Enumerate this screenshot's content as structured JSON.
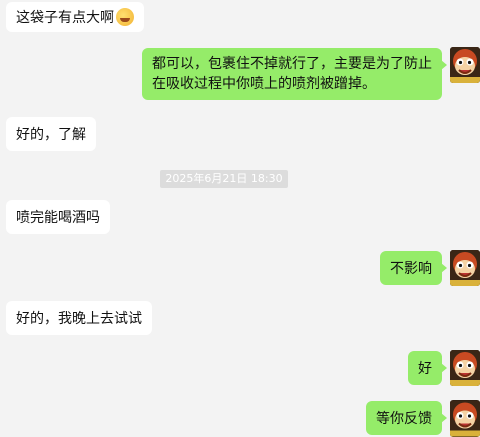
{
  "messages": [
    {
      "side": "in",
      "text": "这袋子有点大啊",
      "emoji": "laughing-tears-emoji"
    },
    {
      "side": "out",
      "text": "都可以，包裹住不掉就行了，主要是为了防止在吸收过程中你喷上的喷剂被蹭掉。"
    },
    {
      "side": "in",
      "text": "好的，了解"
    },
    {
      "side": "in",
      "text": "喷完能喝酒吗"
    },
    {
      "side": "out",
      "text": "不影响"
    },
    {
      "side": "in",
      "text": "好的，我晚上去试试"
    },
    {
      "side": "out",
      "text": "好"
    },
    {
      "side": "out",
      "text": "等你反馈"
    }
  ],
  "timestamp": "2025年6月21日 18:30",
  "avatar_icon": "monkey-cartoon-avatar",
  "colors": {
    "background": "#f3f3f3",
    "incoming_bubble": "#ffffff",
    "outgoing_bubble": "#95ec69",
    "timestamp_bg": "#dcdcdc"
  }
}
